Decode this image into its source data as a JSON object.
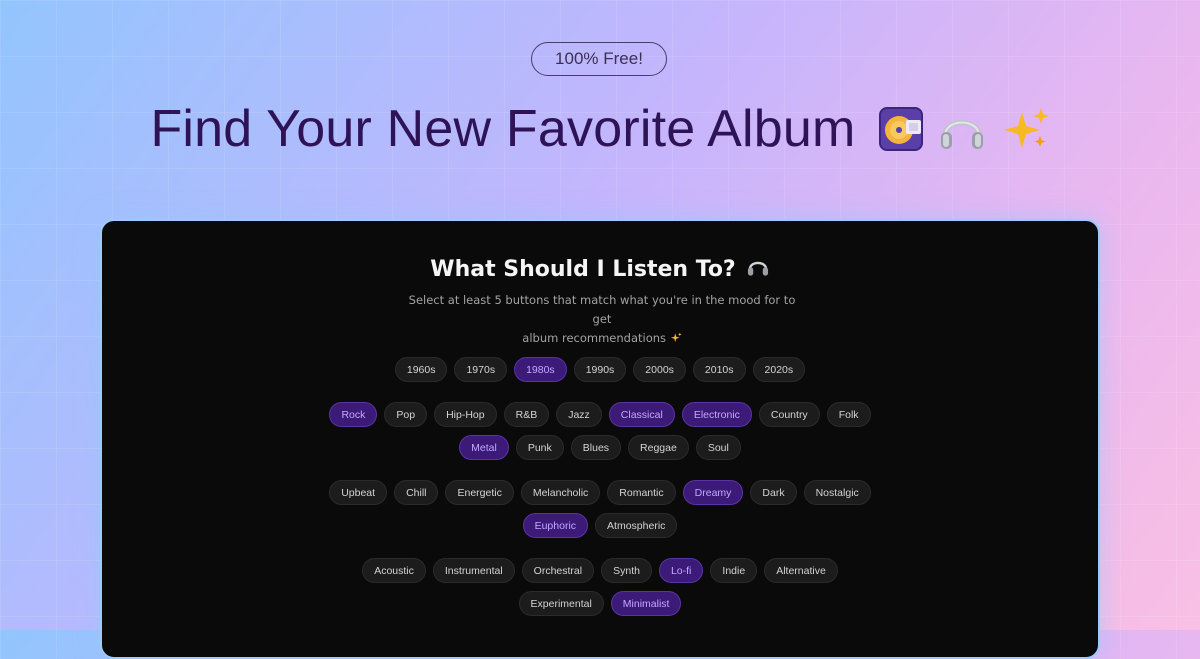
{
  "hero": {
    "badge": "100% Free!",
    "title": "Find Your New Favorite Album",
    "emoji_icons": [
      "minidisc-icon",
      "headphones-icon",
      "sparkles-icon"
    ]
  },
  "card": {
    "title": "What Should I Listen To?",
    "title_icon": "headphones-icon",
    "subtitle_line1": "Select at least 5 buttons that match what you're in the mood for to get",
    "subtitle_line2": "album recommendations",
    "subtitle_icon": "sparkles-icon"
  },
  "groups": {
    "decades": [
      {
        "label": "1960s",
        "selected": false
      },
      {
        "label": "1970s",
        "selected": false
      },
      {
        "label": "1980s",
        "selected": true
      },
      {
        "label": "1990s",
        "selected": false
      },
      {
        "label": "2000s",
        "selected": false
      },
      {
        "label": "2010s",
        "selected": false
      },
      {
        "label": "2020s",
        "selected": false
      }
    ],
    "genres": [
      {
        "label": "Rock",
        "selected": true
      },
      {
        "label": "Pop",
        "selected": false
      },
      {
        "label": "Hip-Hop",
        "selected": false
      },
      {
        "label": "R&B",
        "selected": false
      },
      {
        "label": "Jazz",
        "selected": false
      },
      {
        "label": "Classical",
        "selected": true
      },
      {
        "label": "Electronic",
        "selected": true
      },
      {
        "label": "Country",
        "selected": false
      },
      {
        "label": "Folk",
        "selected": false
      },
      {
        "label": "Metal",
        "selected": true
      },
      {
        "label": "Punk",
        "selected": false
      },
      {
        "label": "Blues",
        "selected": false
      },
      {
        "label": "Reggae",
        "selected": false
      },
      {
        "label": "Soul",
        "selected": false
      }
    ],
    "moods": [
      {
        "label": "Upbeat",
        "selected": false
      },
      {
        "label": "Chill",
        "selected": false
      },
      {
        "label": "Energetic",
        "selected": false
      },
      {
        "label": "Melancholic",
        "selected": false
      },
      {
        "label": "Romantic",
        "selected": false
      },
      {
        "label": "Dreamy",
        "selected": true
      },
      {
        "label": "Dark",
        "selected": false
      },
      {
        "label": "Nostalgic",
        "selected": false
      },
      {
        "label": "Euphoric",
        "selected": true
      },
      {
        "label": "Atmospheric",
        "selected": false
      }
    ],
    "styles": [
      {
        "label": "Acoustic",
        "selected": false
      },
      {
        "label": "Instrumental",
        "selected": false
      },
      {
        "label": "Orchestral",
        "selected": false
      },
      {
        "label": "Synth",
        "selected": false
      },
      {
        "label": "Lo-fi",
        "selected": true
      },
      {
        "label": "Indie",
        "selected": false
      },
      {
        "label": "Alternative",
        "selected": false
      },
      {
        "label": "Experimental",
        "selected": false
      },
      {
        "label": "Minimalist",
        "selected": true
      }
    ]
  },
  "colors": {
    "selected_bg": "#3b1a78",
    "selected_text": "#c4a8ff",
    "chip_bg": "#1c1c1c",
    "card_bg": "#0a0a0a",
    "title_color": "#2e1456"
  }
}
